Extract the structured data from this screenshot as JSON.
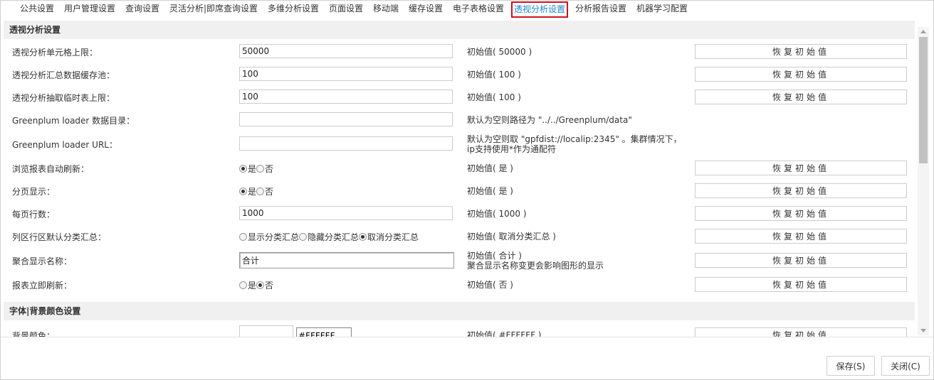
{
  "tabs": [
    {
      "label": "公共设置"
    },
    {
      "label": "用户管理设置"
    },
    {
      "label": "查询设置"
    },
    {
      "label": "灵活分析|即席查询设置"
    },
    {
      "label": "多维分析设置"
    },
    {
      "label": "页面设置"
    },
    {
      "label": "移动端"
    },
    {
      "label": "缓存设置"
    },
    {
      "label": "电子表格设置"
    },
    {
      "label": "透视分析设置"
    },
    {
      "label": "分析报告设置"
    },
    {
      "label": "机器学习配置"
    }
  ],
  "active_tab": "透视分析设置",
  "restore_label": "恢复初始值",
  "section1": {
    "title": "透视分析设置"
  },
  "section2": {
    "title": "字体|背景颜色设置"
  },
  "rows": [
    {
      "label": "透视分析单元格上限：",
      "value": "50000",
      "note": "初始值( 50000 )"
    },
    {
      "label": "透视分析汇总数据缓存池：",
      "value": "100",
      "note": "初始值( 100 )"
    },
    {
      "label": "透视分析抽取临时表上限：",
      "value": "100",
      "note": "初始值( 100 )"
    },
    {
      "label": "Greenplum loader 数据目录：",
      "value": "",
      "note": "默认为空则路径为 \"../../Greenplum/data\""
    },
    {
      "label": "Greenplum loader URL：",
      "value": "",
      "note_line1": "默认为空则取 \"gpfdist://localip:2345\" 。集群情况下，",
      "note_line2": "ip支持使用*作为通配符"
    },
    {
      "label": "浏览报表自动刷新：",
      "options": [
        "是",
        "否"
      ],
      "selected": "是",
      "note": "初始值( 是 )"
    },
    {
      "label": "分页显示：",
      "options": [
        "是",
        "否"
      ],
      "selected": "是",
      "note": "初始值( 是 )"
    },
    {
      "label": "每页行数：",
      "value": "1000",
      "note": "初始值( 1000 )"
    },
    {
      "label": "列区行区默认分类汇总：",
      "options": [
        "显示分类汇总",
        "隐藏分类汇总",
        "取消分类汇总"
      ],
      "selected": "取消分类汇总",
      "note": "初始值( 取消分类汇总 )"
    },
    {
      "label": "聚合显示名称：",
      "value": "合计",
      "note_line1": "初始值( 合计 )",
      "note_line2": "聚合显示名称变更会影响图形的显示"
    },
    {
      "label": "报表立即刷新：",
      "options": [
        "是",
        "否"
      ],
      "selected": "否",
      "note": "初始值( 否 )"
    },
    {
      "label": "背景颜色：",
      "value": "#FFFFFF",
      "note": "初始值( #FFFFFF )",
      "color": "#FFFFFF"
    }
  ],
  "footer": {
    "save_label": "保存(S)",
    "close_label": "关闭(C)"
  },
  "colors": {
    "active_tab_text": "#1e86d0",
    "active_tab_border": "#d0111b",
    "section_bg": "#f0f0f0"
  }
}
